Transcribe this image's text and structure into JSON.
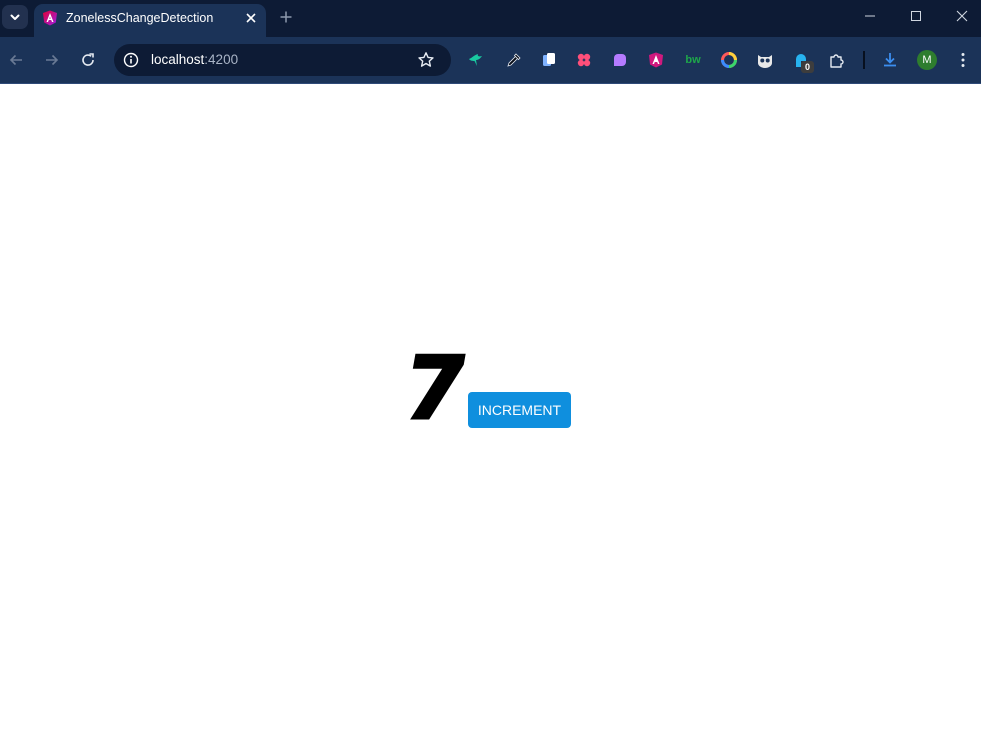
{
  "browser": {
    "tab": {
      "title": "ZonelessChangeDetection",
      "favicon": "angular-icon"
    },
    "omnibox": {
      "host": "localhost",
      "port": ":4200"
    },
    "extensions": [
      "bird-icon",
      "eyedropper-icon",
      "copy-icon",
      "flower-icon",
      "shape-icon",
      "angular-devtools-icon",
      "bw-text-icon",
      "color-ring-icon",
      "owl-icon",
      "extension-counter-icon",
      "puzzle-icon"
    ],
    "ext_bw_label": "bw",
    "extension_badge": "0",
    "avatar_letter": "M"
  },
  "app": {
    "counter_value": "7",
    "increment_label": "INCREMENT"
  },
  "colors": {
    "tabstrip": "#0d1b35",
    "toolbar": "#1b3358",
    "button": "#0f8fde"
  }
}
